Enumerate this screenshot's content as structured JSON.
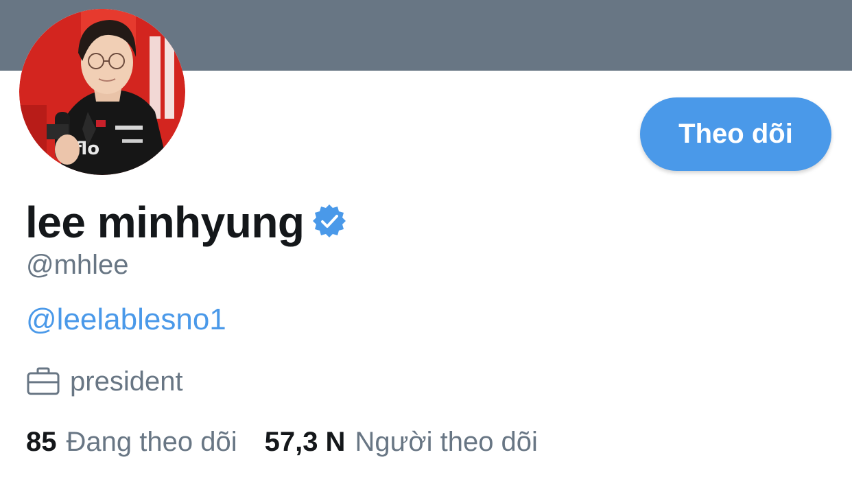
{
  "profile": {
    "display_name": "lee minhyung",
    "verified": true,
    "handle": "@mhlee",
    "bio_link": "@leelablesno1",
    "job": "president"
  },
  "actions": {
    "follow_label": "Theo dõi"
  },
  "stats": {
    "following_count": "85",
    "following_label": "Đang theo dõi",
    "followers_count": "57,3 N",
    "followers_label": "Người theo dõi"
  },
  "colors": {
    "banner": "#687684",
    "accent": "#4a99e9",
    "text_primary": "#14171a",
    "text_secondary": "#687684"
  },
  "icons": {
    "verified": "verified-badge-icon",
    "job": "briefcase-icon"
  }
}
